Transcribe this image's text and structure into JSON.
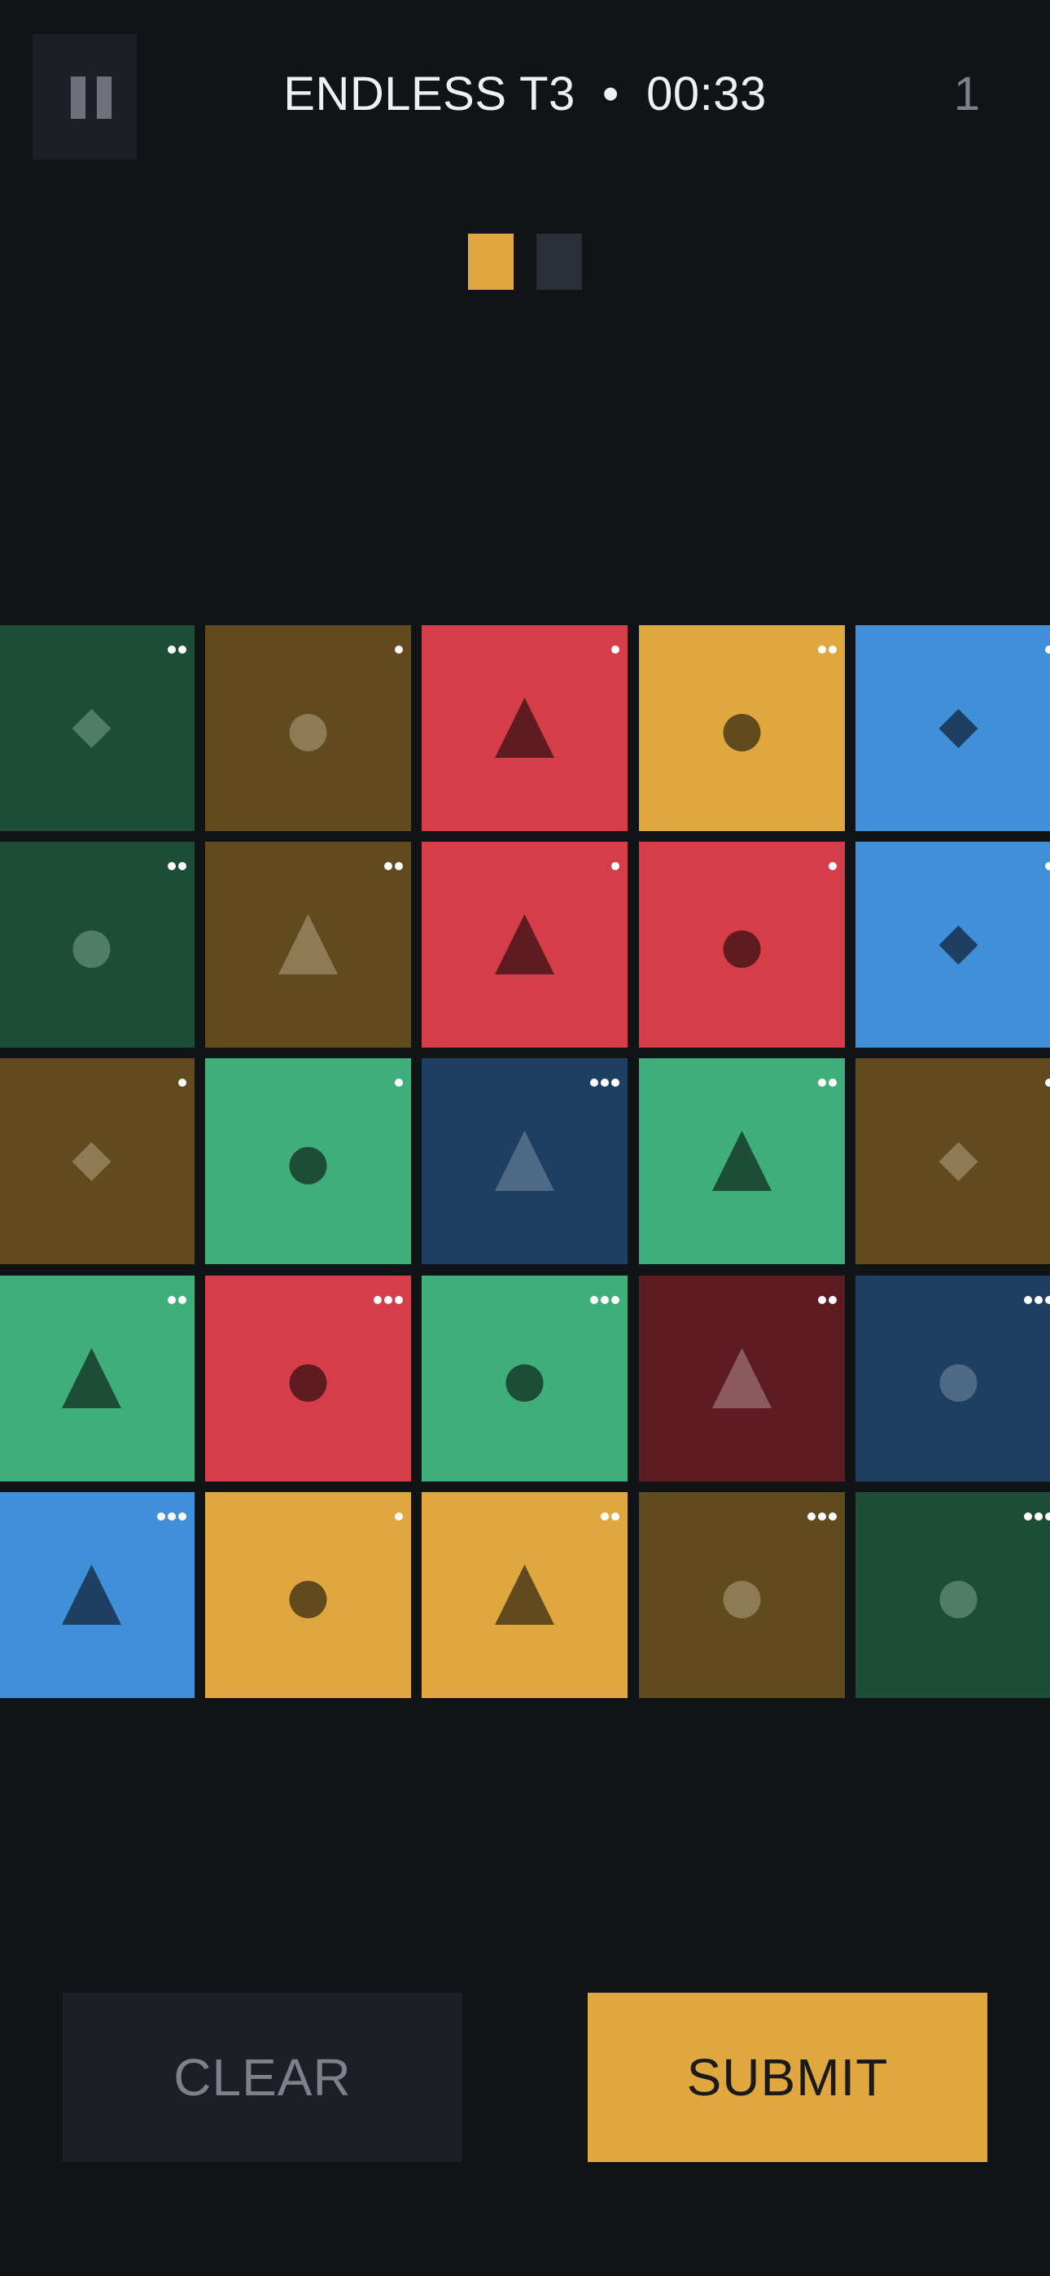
{
  "hud": {
    "mode": "ENDLESS T3",
    "separator": "•",
    "timer": "00:33",
    "score": "1"
  },
  "sequence_indicators": [
    {
      "state": "active",
      "color": "#dfa73e"
    },
    {
      "state": "pending",
      "color": "#2a2e38"
    }
  ],
  "palette": {
    "dark-green": "#1e4d37",
    "brown": "#614a1d",
    "red": "#d53e48",
    "gold": "#dfa73e",
    "light-blue": "#4090d9",
    "green": "#3fae7a",
    "navy": "#1e3f61",
    "maroon": "#5e1c22"
  },
  "grid": {
    "rows": 5,
    "cols": 5,
    "tiles": [
      {
        "color": "dark-green",
        "shape": "diamond",
        "dots": 2,
        "symbol_color": "#4f7d65"
      },
      {
        "color": "brown",
        "shape": "circle",
        "dots": 1,
        "symbol_color": "#8e7a55"
      },
      {
        "color": "red",
        "shape": "triangle",
        "dots": 1,
        "symbol_color": "#5e1c22"
      },
      {
        "color": "gold",
        "shape": "circle",
        "dots": 2,
        "symbol_color": "#614a1d"
      },
      {
        "color": "light-blue",
        "shape": "diamond",
        "dots": 1,
        "symbol_color": "#1e3f61"
      },
      {
        "color": "dark-green",
        "shape": "circle",
        "dots": 2,
        "symbol_color": "#4f7d65"
      },
      {
        "color": "brown",
        "shape": "triangle",
        "dots": 2,
        "symbol_color": "#8e7a55"
      },
      {
        "color": "red",
        "shape": "triangle",
        "dots": 1,
        "symbol_color": "#5e1c22"
      },
      {
        "color": "red",
        "shape": "circle",
        "dots": 1,
        "symbol_color": "#5e1c22"
      },
      {
        "color": "light-blue",
        "shape": "diamond",
        "dots": 1,
        "symbol_color": "#1e3f61"
      },
      {
        "color": "brown",
        "shape": "diamond",
        "dots": 1,
        "symbol_color": "#8e7a55"
      },
      {
        "color": "green",
        "shape": "circle",
        "dots": 1,
        "symbol_color": "#1e4d37"
      },
      {
        "color": "navy",
        "shape": "triangle",
        "dots": 3,
        "symbol_color": "#4f6a87"
      },
      {
        "color": "green",
        "shape": "triangle",
        "dots": 2,
        "symbol_color": "#1e4d37"
      },
      {
        "color": "brown",
        "shape": "diamond",
        "dots": 1,
        "symbol_color": "#8e7a55"
      },
      {
        "color": "green",
        "shape": "triangle",
        "dots": 2,
        "symbol_color": "#1e4d37"
      },
      {
        "color": "red",
        "shape": "circle",
        "dots": 3,
        "symbol_color": "#5e1c22"
      },
      {
        "color": "green",
        "shape": "circle",
        "dots": 3,
        "symbol_color": "#1e4d37"
      },
      {
        "color": "maroon",
        "shape": "triangle",
        "dots": 2,
        "symbol_color": "#8a5a5e"
      },
      {
        "color": "navy",
        "shape": "circle",
        "dots": 3,
        "symbol_color": "#4f6a87"
      },
      {
        "color": "light-blue",
        "shape": "triangle",
        "dots": 3,
        "symbol_color": "#1e3f61"
      },
      {
        "color": "gold",
        "shape": "circle",
        "dots": 1,
        "symbol_color": "#614a1d"
      },
      {
        "color": "gold",
        "shape": "triangle",
        "dots": 2,
        "symbol_color": "#614a1d"
      },
      {
        "color": "brown",
        "shape": "circle",
        "dots": 3,
        "symbol_color": "#8e7a55"
      },
      {
        "color": "dark-green",
        "shape": "circle",
        "dots": 3,
        "symbol_color": "#4f7d65"
      }
    ]
  },
  "buttons": {
    "clear_label": "CLEAR",
    "submit_label": "SUBMIT"
  }
}
